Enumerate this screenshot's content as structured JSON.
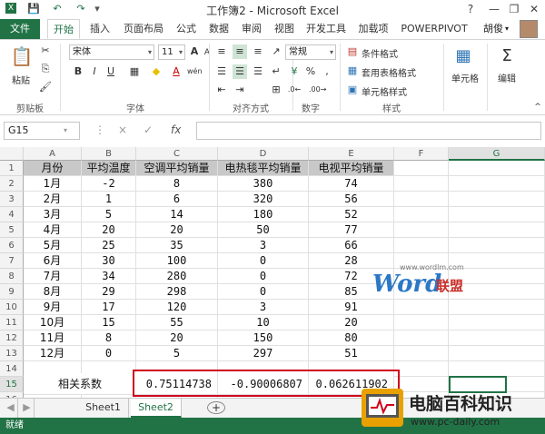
{
  "window": {
    "title": "工作簿2 - Microsoft Excel",
    "help": "?",
    "minimize": "—",
    "restore": "❐",
    "close": "✕"
  },
  "quick_access": {
    "save": "💾",
    "undo": "↶",
    "redo": "↷",
    "customize": "▾"
  },
  "tabs": [
    "文件",
    "开始",
    "插入",
    "页面布局",
    "公式",
    "数据",
    "审阅",
    "视图",
    "开发工具",
    "加载项",
    "POWERPIVOT"
  ],
  "active_tab": "开始",
  "user": "胡俊",
  "ribbon": {
    "clipboard": {
      "paste": "粘贴",
      "label": "剪贴板"
    },
    "font": {
      "name": "宋体",
      "size": "11",
      "bold": "B",
      "italic": "I",
      "underline": "U",
      "grow": "A",
      "shrink": "A",
      "font_color": "A",
      "phonetic": "wén",
      "label": "字体"
    },
    "alignment": {
      "label": "对齐方式"
    },
    "number": {
      "format": "常规",
      "percent": "%",
      "comma": ",",
      "label": "数字"
    },
    "styles": {
      "conditional": "条件格式",
      "table": "套用表格格式",
      "cell": "单元格样式",
      "label": "样式"
    },
    "cells": {
      "label": "单元格"
    },
    "editing": {
      "label": "编辑"
    }
  },
  "formula_bar": {
    "name_box": "G15",
    "cancel": "×",
    "enter": "✓",
    "fx": "fx",
    "value": ""
  },
  "columns": [
    "A",
    "B",
    "C",
    "D",
    "E",
    "F",
    "G"
  ],
  "selected_column": "G",
  "rows": [
    "1",
    "2",
    "3",
    "4",
    "5",
    "6",
    "7",
    "8",
    "9",
    "10",
    "11",
    "12",
    "13",
    "14",
    "15",
    "16",
    "17"
  ],
  "selected_row": "15",
  "table": {
    "headers": [
      "月份",
      "平均温度",
      "空调平均销量",
      "电热毯平均销量",
      "电视平均销量"
    ],
    "rows": [
      [
        "1月",
        "-2",
        "8",
        "380",
        "74"
      ],
      [
        "2月",
        "1",
        "6",
        "320",
        "56"
      ],
      [
        "3月",
        "5",
        "14",
        "180",
        "52"
      ],
      [
        "4月",
        "20",
        "20",
        "50",
        "77"
      ],
      [
        "5月",
        "25",
        "35",
        "3",
        "66"
      ],
      [
        "6月",
        "30",
        "100",
        "0",
        "28"
      ],
      [
        "7月",
        "34",
        "280",
        "0",
        "72"
      ],
      [
        "8月",
        "29",
        "298",
        "0",
        "85"
      ],
      [
        "9月",
        "17",
        "120",
        "3",
        "91"
      ],
      [
        "10月",
        "15",
        "55",
        "10",
        "20"
      ],
      [
        "11月",
        "8",
        "20",
        "150",
        "80"
      ],
      [
        "12月",
        "0",
        "5",
        "297",
        "51"
      ]
    ]
  },
  "correlation": {
    "label": "相关系数",
    "values": [
      "0.75114738",
      "-0.90006807",
      "0.062611902"
    ]
  },
  "sheets": {
    "tabs": [
      "Sheet1",
      "Sheet2"
    ],
    "active": "Sheet2",
    "add": "+"
  },
  "status": "就绪",
  "watermarks": {
    "wordlm": {
      "url": "www.wordlm.com",
      "word": "Word",
      "union": "联盟"
    },
    "pcdaily": {
      "name": "电脑百科知识",
      "url": "www.pc-daily.com"
    }
  },
  "colors": {
    "excel_green": "#217346",
    "highlight_red": "#d0021b",
    "header_fill": "#c8c8c8"
  }
}
